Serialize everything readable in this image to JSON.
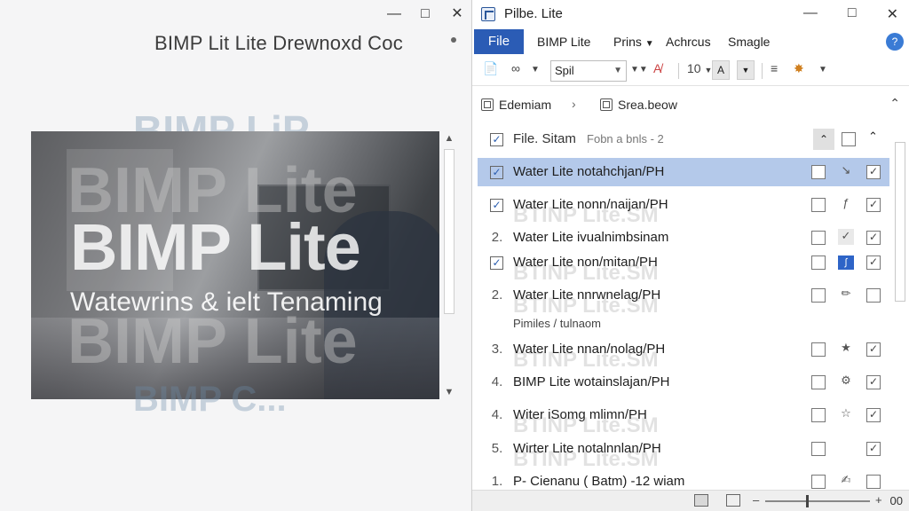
{
  "left_window": {
    "title": "BIMP Lit Lite Drewnoxd Coc",
    "preview": {
      "main_text": "BIMP Lite",
      "sub_text": "Watewrins & ielt Tenaming",
      "ghost_top": "BIMP LiP",
      "ghost_repeat": "BIMP Lite",
      "ghost_bottom": "BIMP C..."
    }
  },
  "right_window": {
    "title": "Pilbe. Lite",
    "menu": {
      "file": "File",
      "items": [
        "BIMP Lite",
        "Prins",
        "Achrcus",
        "Smagle"
      ]
    },
    "toolbar": {
      "font_name": "Spil",
      "size_label": "10"
    },
    "breadcrumb": {
      "first": "Edemiam",
      "second": "Srea.beow"
    },
    "list_header": {
      "label": "File. Sitam",
      "meta": "Fobn a bnls - 2"
    },
    "rows": [
      {
        "lead": "☑",
        "label": "Water Lite notahchjan/PH",
        "selected": true,
        "ghost": ""
      },
      {
        "lead": "☑",
        "label": "Water Lite nonn/naijan/PH",
        "selected": false,
        "ghost": "BTINP Lite.SM"
      },
      {
        "lead": "2.",
        "label": "Water Lite ivualnimbsinam",
        "selected": false,
        "ghost": ""
      },
      {
        "lead": "☑",
        "label": "Water Lite non/mitan/PH",
        "selected": false,
        "ghost": "BTINP Lite.SM"
      },
      {
        "lead": "2.",
        "label": "Water Lite nnrwnelag/PH",
        "selected": false,
        "ghost": "BTINP Lite.SM"
      },
      {
        "lead": "",
        "label": "Pimiles / tulnaom",
        "selected": false,
        "ghost": ""
      },
      {
        "lead": "3.",
        "label": "Water Lite nnan/nolag/PH",
        "selected": false,
        "ghost": "BTINP Lite.SM"
      },
      {
        "lead": "4.",
        "label": "BIMP Lite wotainslajan/PH",
        "selected": false,
        "ghost": ""
      },
      {
        "lead": "4.",
        "label": "Witer iSomg mlimn/PH",
        "selected": false,
        "ghost": "BTINP Lite.SM"
      },
      {
        "lead": "5.",
        "label": "Wirter Lite notalnnlan/PH",
        "selected": false,
        "ghost": "BTINP Lite.SM"
      },
      {
        "lead": "1.",
        "label": "P- Cienanu ( Batm) -12 wiam",
        "selected": false,
        "ghost": ""
      }
    ],
    "statusbar": {
      "zoom": "00"
    }
  }
}
